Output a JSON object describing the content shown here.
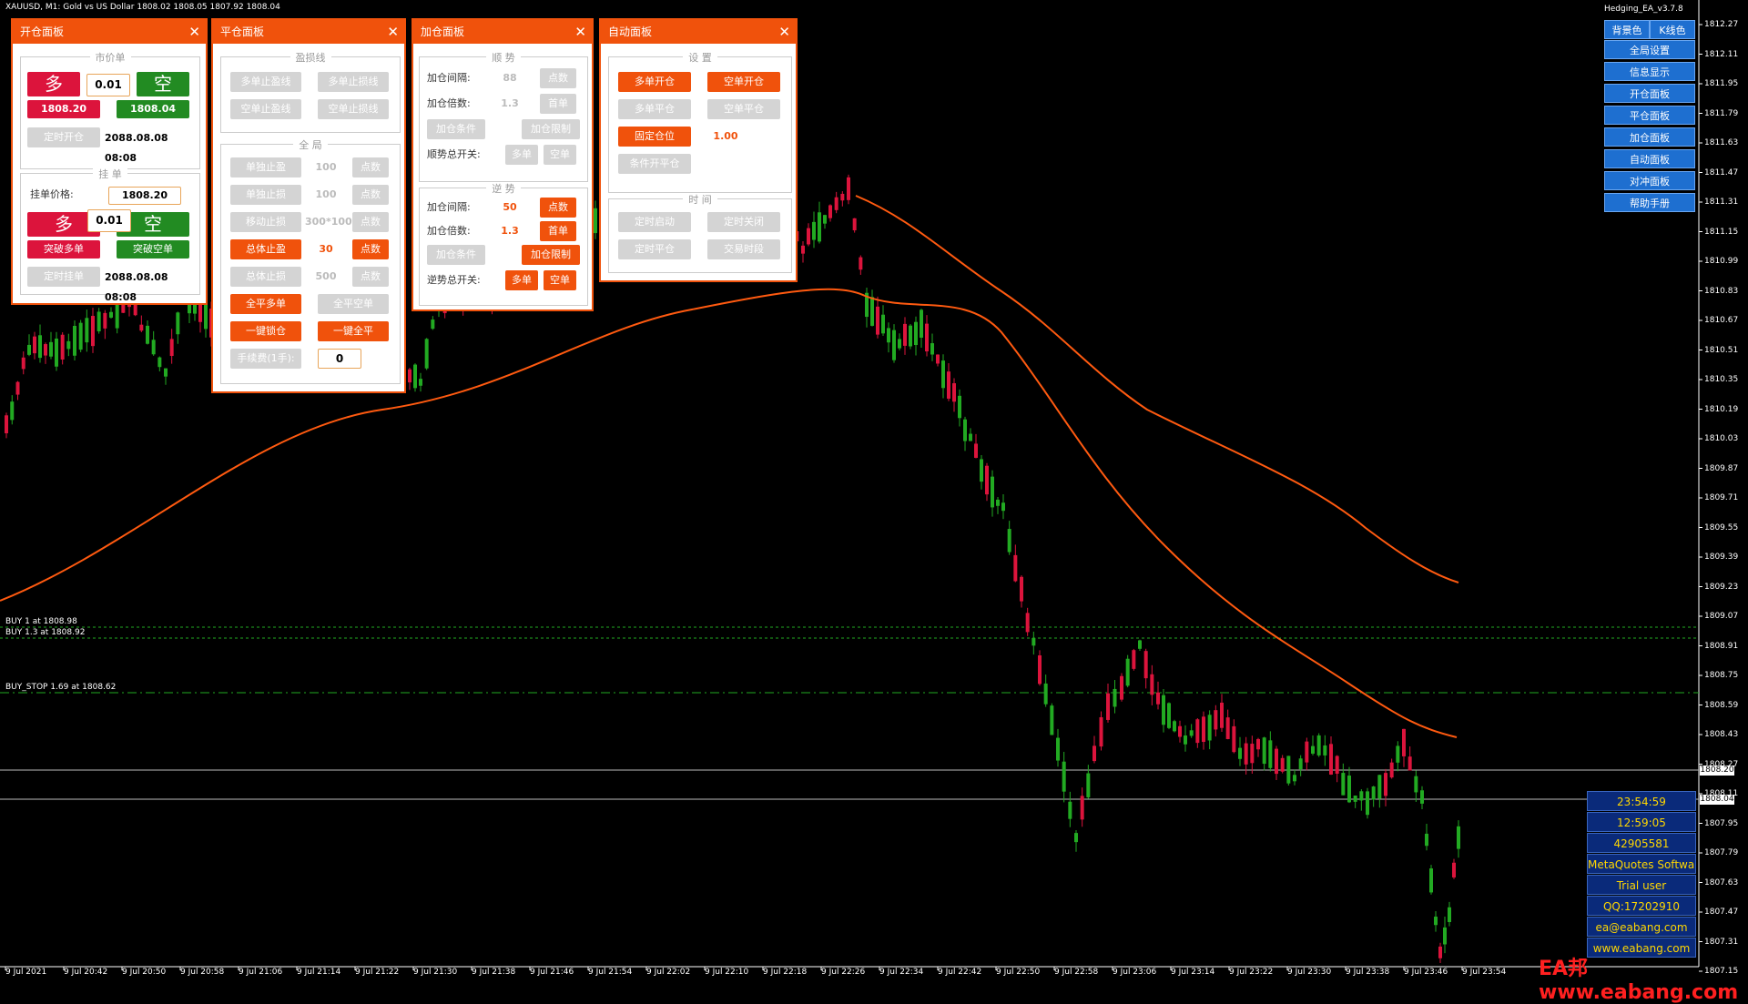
{
  "chart": {
    "info": "XAUUSD, M1:  Gold vs US Dollar  1808.02 1808.05 1807.92 1808.04",
    "hlines": [
      {
        "label": "BUY 1 at 1808.98",
        "color": "#22aa22"
      },
      {
        "label": "BUY 1.3 at 1808.92",
        "color": "#22aa22"
      },
      {
        "label": "BUY_STOP 1.69 at 1808.62",
        "color": "#22aa22"
      }
    ],
    "bid_tag": "1808.20",
    "ask_tag": "1808.04",
    "y_ticks": [
      "1812.27",
      "1812.11",
      "1811.95",
      "1811.79",
      "1811.63",
      "1811.47",
      "1811.31",
      "1811.15",
      "1810.99",
      "1810.83",
      "1810.67",
      "1810.51",
      "1810.35",
      "1810.19",
      "1810.03",
      "1809.87",
      "1809.71",
      "1809.55",
      "1809.39",
      "1809.23",
      "1809.07",
      "1808.91",
      "1808.75",
      "1808.59",
      "1808.43",
      "1808.27",
      "1808.11",
      "1807.95",
      "1807.79",
      "1807.63",
      "1807.47",
      "1807.31",
      "1807.15"
    ],
    "x_ticks": [
      "9 Jul 2021",
      "9 Jul 20:42",
      "9 Jul 20:50",
      "9 Jul 20:58",
      "9 Jul 21:06",
      "9 Jul 21:14",
      "9 Jul 21:22",
      "9 Jul 21:30",
      "9 Jul 21:38",
      "9 Jul 21:46",
      "9 Jul 21:54",
      "9 Jul 22:02",
      "9 Jul 22:10",
      "9 Jul 22:18",
      "9 Jul 22:26",
      "9 Jul 22:34",
      "9 Jul 22:42",
      "9 Jul 22:50",
      "9 Jul 22:58",
      "9 Jul 23:06",
      "9 Jul 23:14",
      "9 Jul 23:22",
      "9 Jul 23:30",
      "9 Jul 23:38",
      "9 Jul 23:46",
      "9 Jul 23:54"
    ]
  },
  "panel_open": {
    "title": "开仓面板",
    "close": "✕",
    "market_group": "市价单",
    "buy_label": "多",
    "sell_label": "空",
    "lot": "0.01",
    "buy_price": "1808.20",
    "sell_price": "1808.04",
    "timed_open": "定时开仓",
    "timed_open_time": "2088.08.08 08:08",
    "pending_group": "挂  单",
    "pending_price_label": "挂单价格:",
    "pending_price": "1808.20",
    "pending_buy": "多",
    "pending_sell": "空",
    "pending_lot": "0.01",
    "breakout_buy": "突破多单",
    "breakout_sell": "突破空单",
    "timed_pending": "定时挂单",
    "timed_pending_time": "2088.08.08 08:08"
  },
  "panel_close": {
    "title": "平仓面板",
    "close": "✕",
    "sltp_group": "盈损线",
    "buy_tp_line": "多单止盈线",
    "buy_sl_line": "多单止损线",
    "sell_tp_line": "空单止盈线",
    "sell_sl_line": "空单止损线",
    "global_group": "全  局",
    "single_tp": "单独止盈",
    "single_tp_val": "100",
    "single_sl": "单独止损",
    "single_sl_val": "100",
    "trailing_sl": "移动止损",
    "trailing_val": "300*100",
    "total_tp": "总体止盈",
    "total_tp_val": "30",
    "total_sl": "总体止损",
    "total_sl_val": "500",
    "points": "点数",
    "close_all_buy": "全平多单",
    "close_all_sell": "全平空单",
    "lock": "一键锁仓",
    "close_all": "一键全平",
    "fee_label": "手续费(1手):",
    "fee_val": "0"
  },
  "panel_add": {
    "title": "加仓面板",
    "close": "✕",
    "trend_group": "顺  势",
    "interval_label": "加仓间隔:",
    "interval_val": "88",
    "mult_label": "加仓倍数:",
    "mult_val": "1.3",
    "points": "点数",
    "first_order": "首单",
    "add_cond": "加仓条件",
    "add_limit": "加仓限制",
    "trend_switch": "顺势总开关:",
    "buy": "多单",
    "sell": "空单",
    "counter_group": "逆  势",
    "c_interval_val": "50",
    "c_mult_val": "1.3",
    "counter_switch": "逆势总开关:"
  },
  "panel_auto": {
    "title": "自动面板",
    "close": "✕",
    "settings_group": "设  置",
    "buy_open": "多单开仓",
    "sell_open": "空单开仓",
    "buy_close": "多单平仓",
    "sell_close": "空单平仓",
    "fixed_lot": "固定仓位",
    "fixed_lot_val": "1.00",
    "cond_open_close": "条件开平仓",
    "time_group": "时  间",
    "timed_start": "定时启动",
    "timed_stop": "定时关闭",
    "timed_close": "定时平仓",
    "trade_session": "交易时段"
  },
  "right_menu": {
    "ea_title": "Hedging_EA_v3.7.8",
    "bg_color": "背景色",
    "k_color": "K线色",
    "items": [
      "全局设置",
      "信息显示",
      "开仓面板",
      "平仓面板",
      "加仓面板",
      "自动面板",
      "对冲面板",
      "帮助手册"
    ]
  },
  "info_box": [
    "23:54:59",
    "12:59:05",
    "42905581",
    "MetaQuotes Software Corp.",
    "Trial user",
    "QQ:17202910",
    "ea@eabang.com",
    "www.eabang.com"
  ],
  "watermark": "EA邦  www.eabang.com"
}
